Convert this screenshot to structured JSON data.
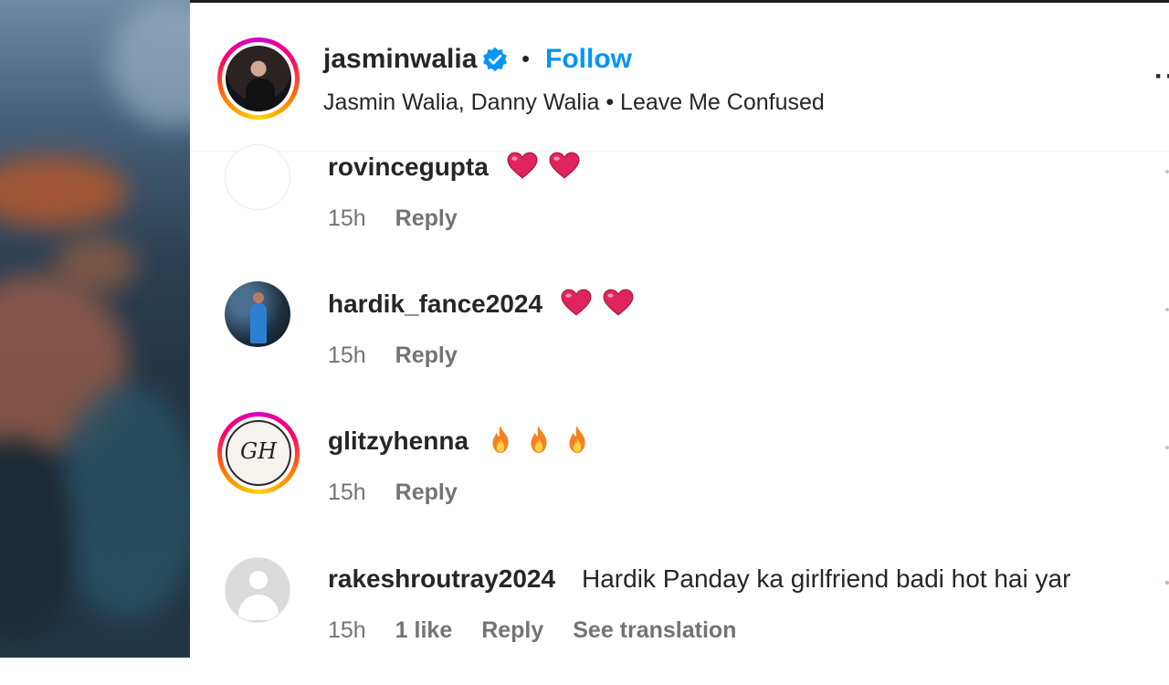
{
  "post": {
    "author": "jasminwalia",
    "separator": "•",
    "follow_label": "Follow",
    "subtitle": "Jasmin Walia, Danny Walia • Leave Me Confused",
    "more_label": "··"
  },
  "comments": [
    {
      "user": "rovincegupta",
      "text": "",
      "emojis": [
        "red-heart",
        "red-heart"
      ],
      "time": "15h",
      "likes": "",
      "reply_label": "Reply",
      "translate_label": ""
    },
    {
      "user": "hardik_fance2024",
      "text": "",
      "emojis": [
        "red-heart",
        "red-heart"
      ],
      "time": "15h",
      "likes": "",
      "reply_label": "Reply",
      "translate_label": ""
    },
    {
      "user": "glitzyhenna",
      "text": "",
      "emojis": [
        "fire",
        "fire",
        "fire"
      ],
      "time": "15h",
      "likes": "",
      "reply_label": "Reply",
      "translate_label": "",
      "avatar_text": "GH"
    },
    {
      "user": "rakeshroutray2024",
      "text": "Hardik Panday ka girlfriend badi hot hai yar",
      "emojis": [],
      "time": "15h",
      "likes": "1 like",
      "reply_label": "Reply",
      "translate_label": "See translation"
    }
  ],
  "colors": {
    "accent": "#0095f6",
    "text": "#262626",
    "secondary": "#737373",
    "heart": "#e0245e",
    "fire": "#f58220"
  }
}
